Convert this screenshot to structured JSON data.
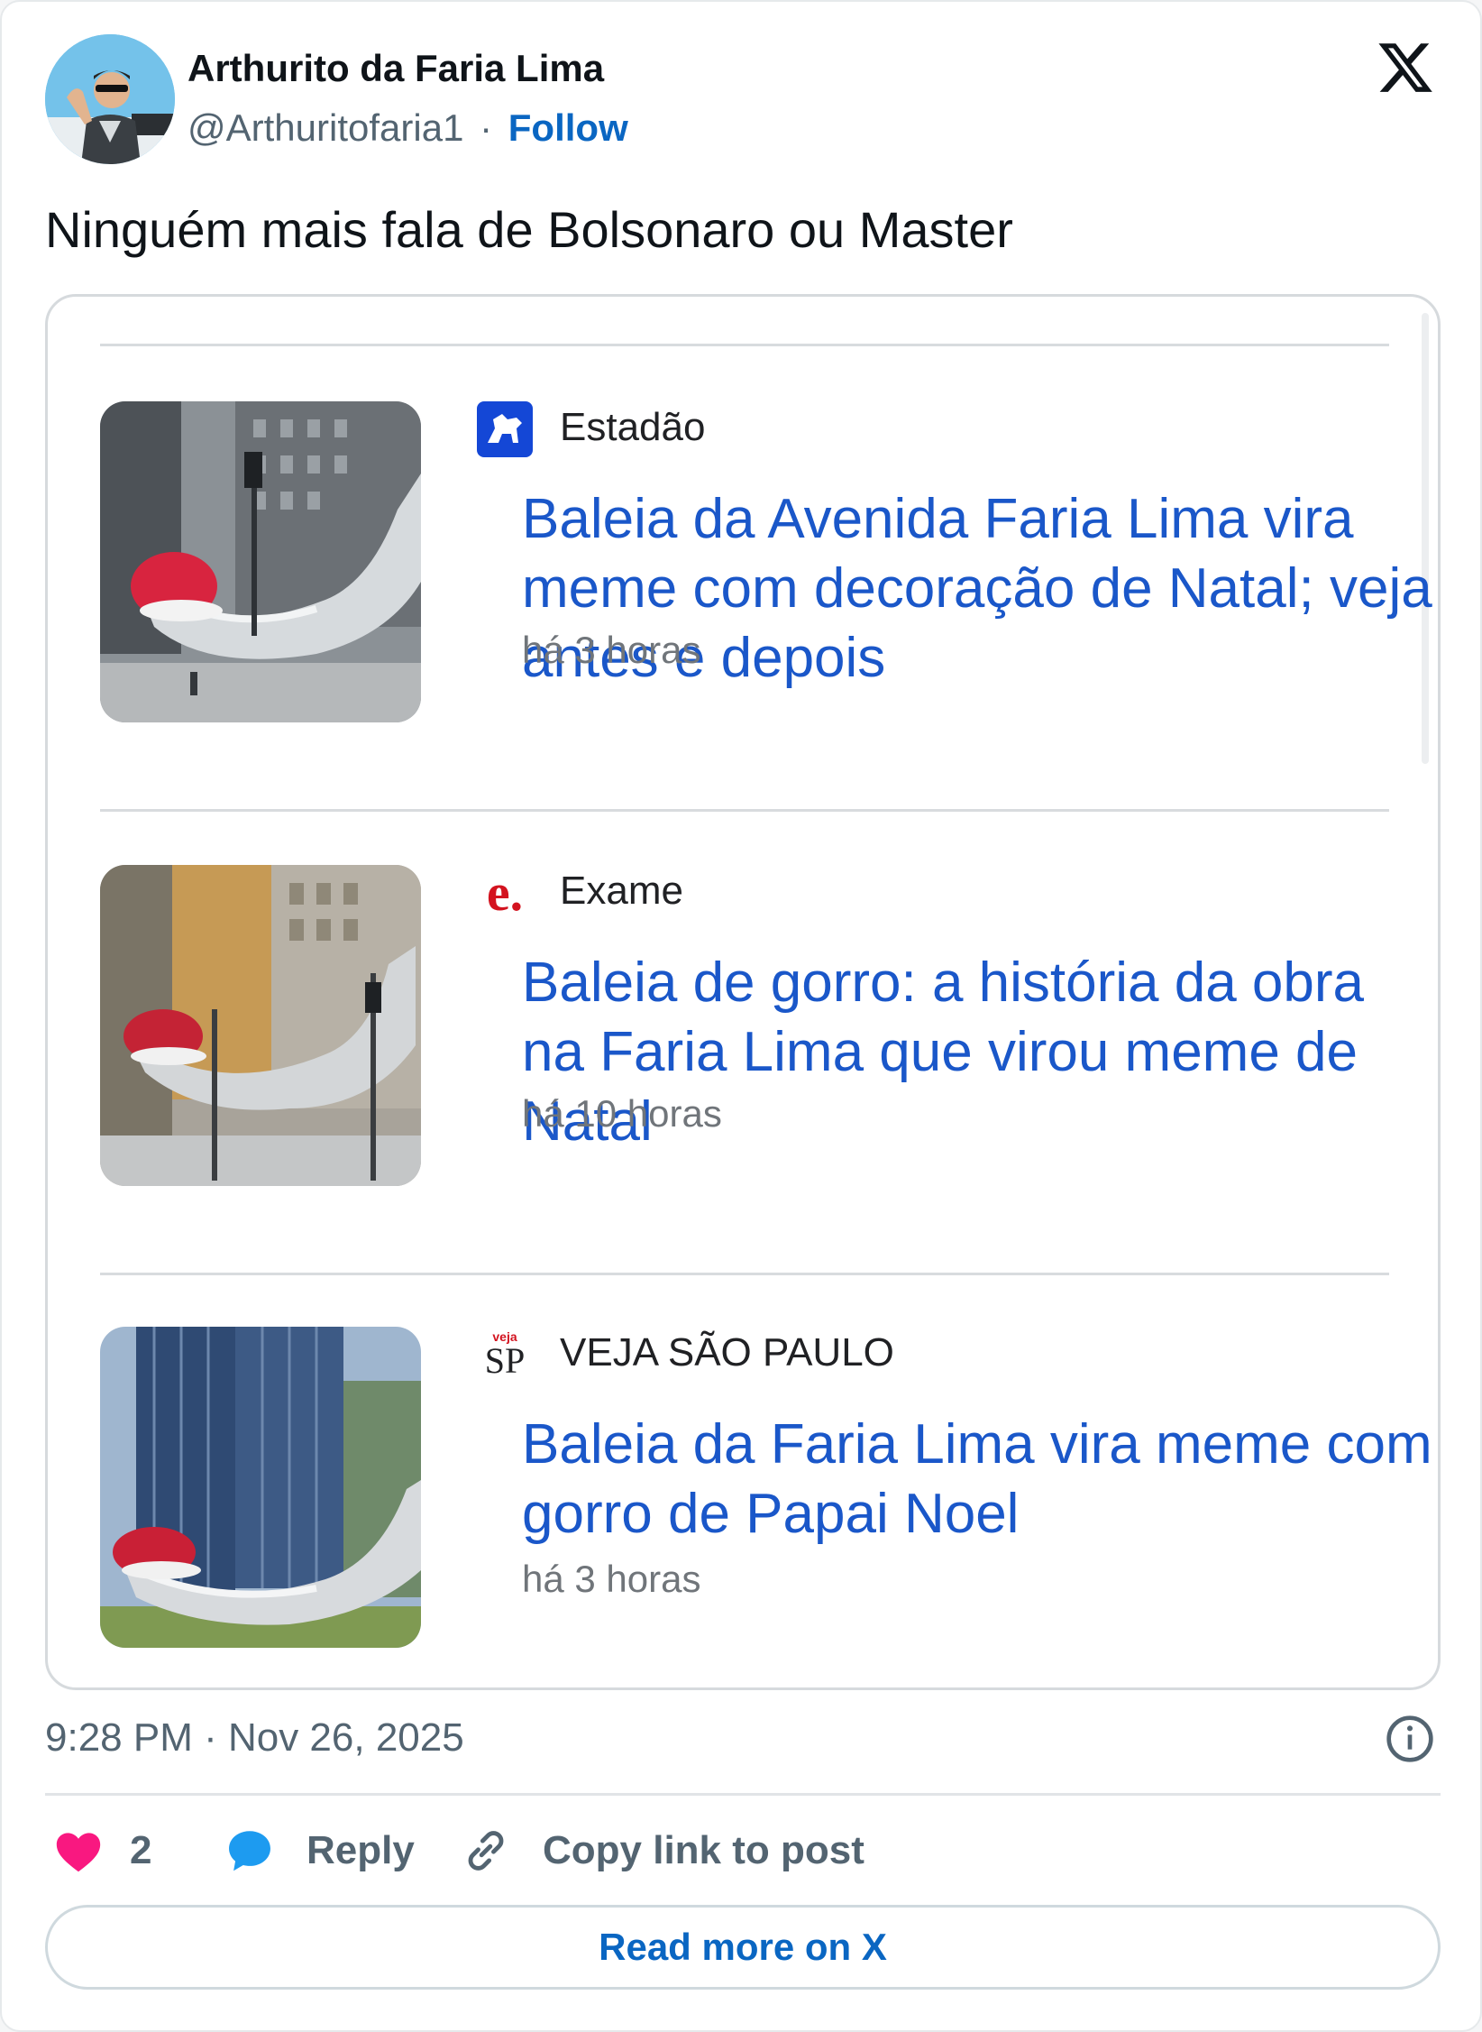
{
  "author": {
    "name": "Arthurito da Faria Lima",
    "handle": "@Arthuritofaria1",
    "separator": "·",
    "follow_label": "Follow"
  },
  "post": {
    "text": "Ninguém mais fala de Bolsonaro ou Master"
  },
  "news": [
    {
      "source": "Estadão",
      "source_icon": "estadao-horse-logo",
      "headline": "Baleia da Avenida Faria Lima vira meme com decoração de Natal; veja antes e depois",
      "age": "há 3 horas"
    },
    {
      "source": "Exame",
      "source_icon": "exame-e-logo",
      "logo_text": "e.",
      "headline": "Baleia de gorro: a história da obra na Faria Lima que virou meme de Natal",
      "age": "há 10 horas"
    },
    {
      "source": "VEJA SÃO PAULO",
      "source_icon": "veja-sp-logo",
      "logo_top": "veja",
      "logo_bottom": "SP",
      "headline": "Baleia da Faria Lima vira meme com gorro de Papai Noel",
      "age": "há 3 horas"
    }
  ],
  "meta": {
    "timestamp": "9:28 PM · Nov 26, 2025"
  },
  "actions": {
    "likes": "2",
    "reply_label": "Reply",
    "copy_label": "Copy link to post"
  },
  "read_more_label": "Read more on X",
  "colors": {
    "link": "#0a66c2",
    "headline": "#1a57c9",
    "like": "#f91880",
    "reply": "#1d9bf0"
  }
}
